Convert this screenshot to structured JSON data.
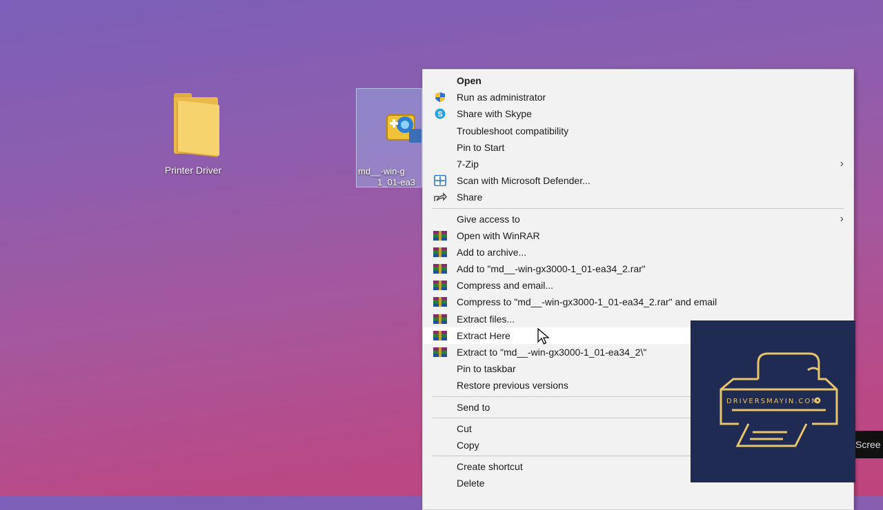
{
  "desktop": {
    "icons": [
      {
        "label": "Printer Driver",
        "icon": "folder-icon"
      },
      {
        "label_line1": "md__-win-g",
        "label_line2": "1_01-ea3",
        "icon": "installer-icon"
      }
    ]
  },
  "context_menu": {
    "items": [
      {
        "label": "Open"
      },
      {
        "label": "Run as administrator",
        "icon": "uac-shield-icon"
      },
      {
        "label": "Share with Skype",
        "icon": "skype-icon"
      },
      {
        "label": "Troubleshoot compatibility"
      },
      {
        "label": "Pin to Start"
      },
      {
        "label": "7-Zip",
        "submenu": true
      },
      {
        "label": "Scan with Microsoft Defender...",
        "icon": "defender-icon"
      },
      {
        "label": "Share",
        "icon": "share-icon"
      },
      {
        "label": "Give access to",
        "submenu": true
      },
      {
        "label": "Open with WinRAR",
        "icon": "winrar-icon"
      },
      {
        "label": "Add to archive...",
        "icon": "winrar-icon"
      },
      {
        "label": "Add to \"md__-win-gx3000-1_01-ea34_2.rar\"",
        "icon": "winrar-icon"
      },
      {
        "label": "Compress and email...",
        "icon": "winrar-icon"
      },
      {
        "label": "Compress to \"md__-win-gx3000-1_01-ea34_2.rar\" and email",
        "icon": "winrar-icon"
      },
      {
        "label": "Extract files...",
        "icon": "winrar-icon"
      },
      {
        "label": "Extract Here",
        "icon": "winrar-icon"
      },
      {
        "label": "Extract to \"md__-win-gx3000-1_01-ea34_2\\\"",
        "icon": "winrar-icon"
      },
      {
        "label": "Pin to taskbar"
      },
      {
        "label": "Restore previous versions"
      },
      {
        "label": "Send to"
      },
      {
        "label": "Cut"
      },
      {
        "label": "Copy"
      },
      {
        "label": "Create shortcut"
      },
      {
        "label": "Delete"
      }
    ],
    "arrow_glyph": "›"
  },
  "watermark": {
    "text": "DRIVERSMAYIN.COM"
  },
  "edge_text": "Scree",
  "colors": {
    "menu_bg": "#f2f2f2",
    "watermark_bg": "#1f2b52",
    "watermark_gold": "#e8c46a"
  }
}
